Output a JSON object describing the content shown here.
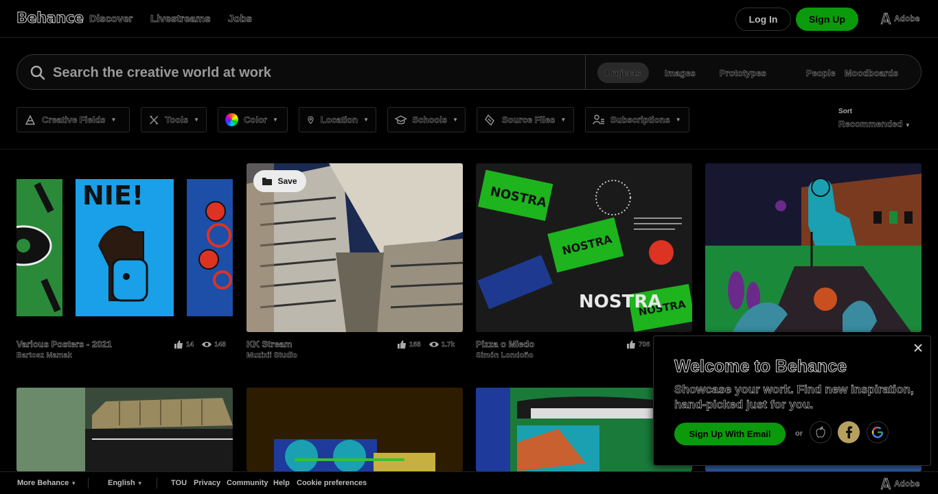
{
  "header": {
    "logo": "Behance",
    "nav": [
      "Discover",
      "Livestreams",
      "Jobs"
    ],
    "login_label": "Log In",
    "signup_label": "Sign Up",
    "adobe_label": "Adobe"
  },
  "search": {
    "placeholder": "Search the creative world at work",
    "tabs": [
      "Projects",
      "Images",
      "Prototypes",
      "People",
      "Moodboards"
    ],
    "active_tab": "Projects"
  },
  "filters": [
    "Creative Fields",
    "Tools",
    "Color",
    "Location",
    "Schools",
    "Source Files",
    "Subscriptions"
  ],
  "sort": {
    "label": "Sort",
    "value": "Recommended"
  },
  "projects": [
    {
      "title": "Various Posters - 2021",
      "owner": "Bartosz Mamak",
      "likes": "14",
      "views": "148"
    },
    {
      "title": "KK Stream",
      "owner": "Muzixii Studio",
      "likes": "168",
      "views": "1.7k",
      "save_label": "Save"
    },
    {
      "title": "Pizza o Miedo",
      "owner": "Simón Londoño",
      "likes": "706",
      "views": ""
    },
    {
      "title": "",
      "owner": "",
      "likes": "",
      "views": ""
    }
  ],
  "welcome": {
    "title": "Welcome to Behance",
    "text": "Showcase your work. Find new inspiration, hand-picked just for you.",
    "email_label": "Sign Up With Email",
    "or_label": "or"
  },
  "footer": {
    "more_label": "More Behance",
    "lang_label": "English",
    "links": [
      "TOU",
      "Privacy",
      "Community",
      "Help",
      "Cookie preferences"
    ],
    "adobe_label": "Adobe"
  },
  "colors": {
    "accent": "#0b9a0b",
    "background": "#000000",
    "facebook": "#b8a060"
  },
  "icons": [
    "search-icon",
    "adobe-icon",
    "creative-fields-icon",
    "tools-icon",
    "color-icon",
    "location-icon",
    "schools-icon",
    "source-files-icon",
    "subscriptions-icon",
    "thumbs-up-icon",
    "eye-icon",
    "folder-icon",
    "close-icon",
    "apple-icon",
    "facebook-icon",
    "google-icon"
  ]
}
